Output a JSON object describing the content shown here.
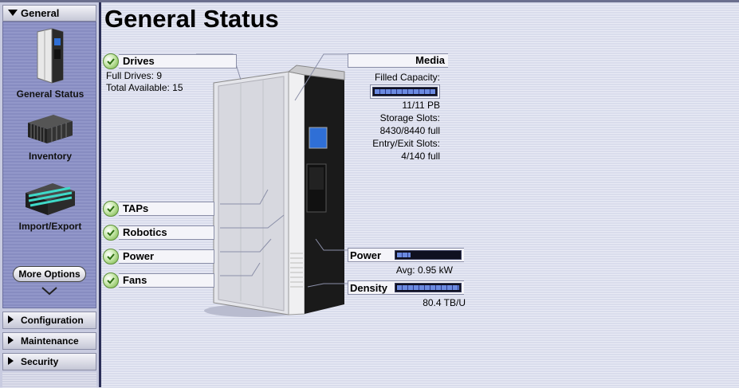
{
  "sidebar": {
    "header_label": "General",
    "items": [
      {
        "label": "General Status"
      },
      {
        "label": "Inventory"
      },
      {
        "label": "Import/Export"
      }
    ],
    "more_options_label": "More Options",
    "sections": [
      {
        "label": "Configuration"
      },
      {
        "label": "Maintenance"
      },
      {
        "label": "Security"
      }
    ]
  },
  "page": {
    "title": "General Status"
  },
  "drives": {
    "label": "Drives",
    "full_drives": "Full Drives: 9",
    "total_available": "Total Available: 15"
  },
  "status_items": [
    {
      "label": "TAPs"
    },
    {
      "label": "Robotics"
    },
    {
      "label": "Power"
    },
    {
      "label": "Fans"
    }
  ],
  "media": {
    "label": "Media",
    "filled_capacity_label": "Filled Capacity:",
    "filled_capacity_fraction": 1.0,
    "filled_capacity_value": "11/11 PB",
    "storage_slots_label": "Storage Slots:",
    "storage_slots_value": "8430/8440 full",
    "entry_exit_label": "Entry/Exit Slots:",
    "entry_exit_value": "4/140 full"
  },
  "power": {
    "label": "Power",
    "fraction": 0.22,
    "value": "Avg: 0.95 kW"
  },
  "density": {
    "label": "Density",
    "fraction": 1.0,
    "value": "80.4 TB/U"
  },
  "colors": {
    "accent": "#8e93c6",
    "ok": "#6fae3d",
    "gauge": "#6b8ae0"
  }
}
